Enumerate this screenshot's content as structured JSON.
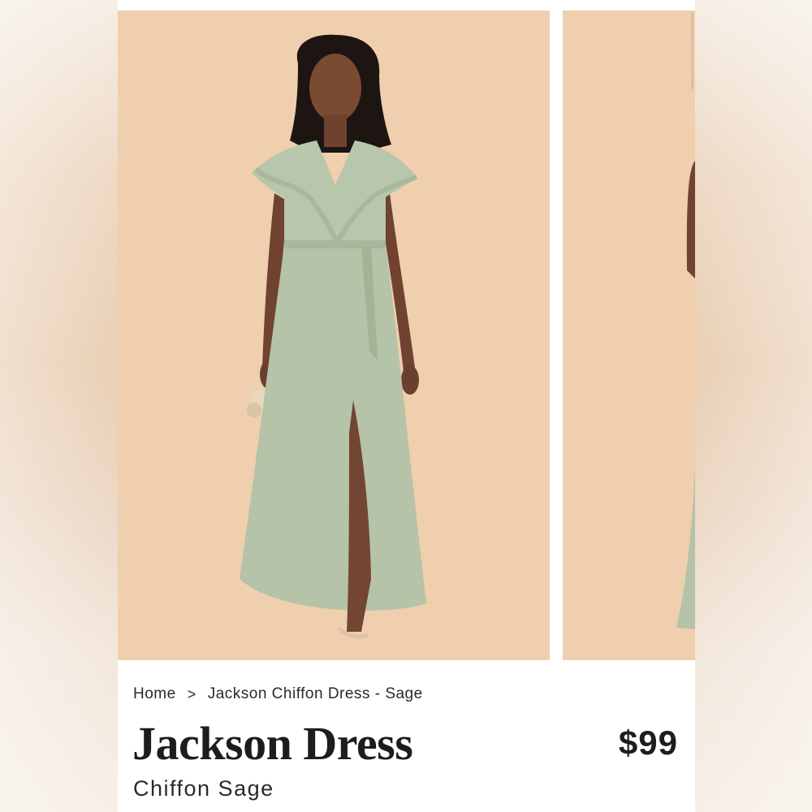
{
  "breadcrumb": {
    "home": "Home",
    "separator": ">",
    "current": "Jackson Chiffon Dress - Sage"
  },
  "product": {
    "name": "Jackson Dress",
    "variant": "Chiffon Sage",
    "price": "$99"
  },
  "gallery": {
    "images": [
      {
        "alt": "model-in-sage-dress-front"
      },
      {
        "alt": "model-in-sage-dress-side"
      }
    ]
  },
  "colors": {
    "image_background": "#efcfad",
    "dress": "#b8c6ac",
    "text": "#1e1d1b"
  }
}
